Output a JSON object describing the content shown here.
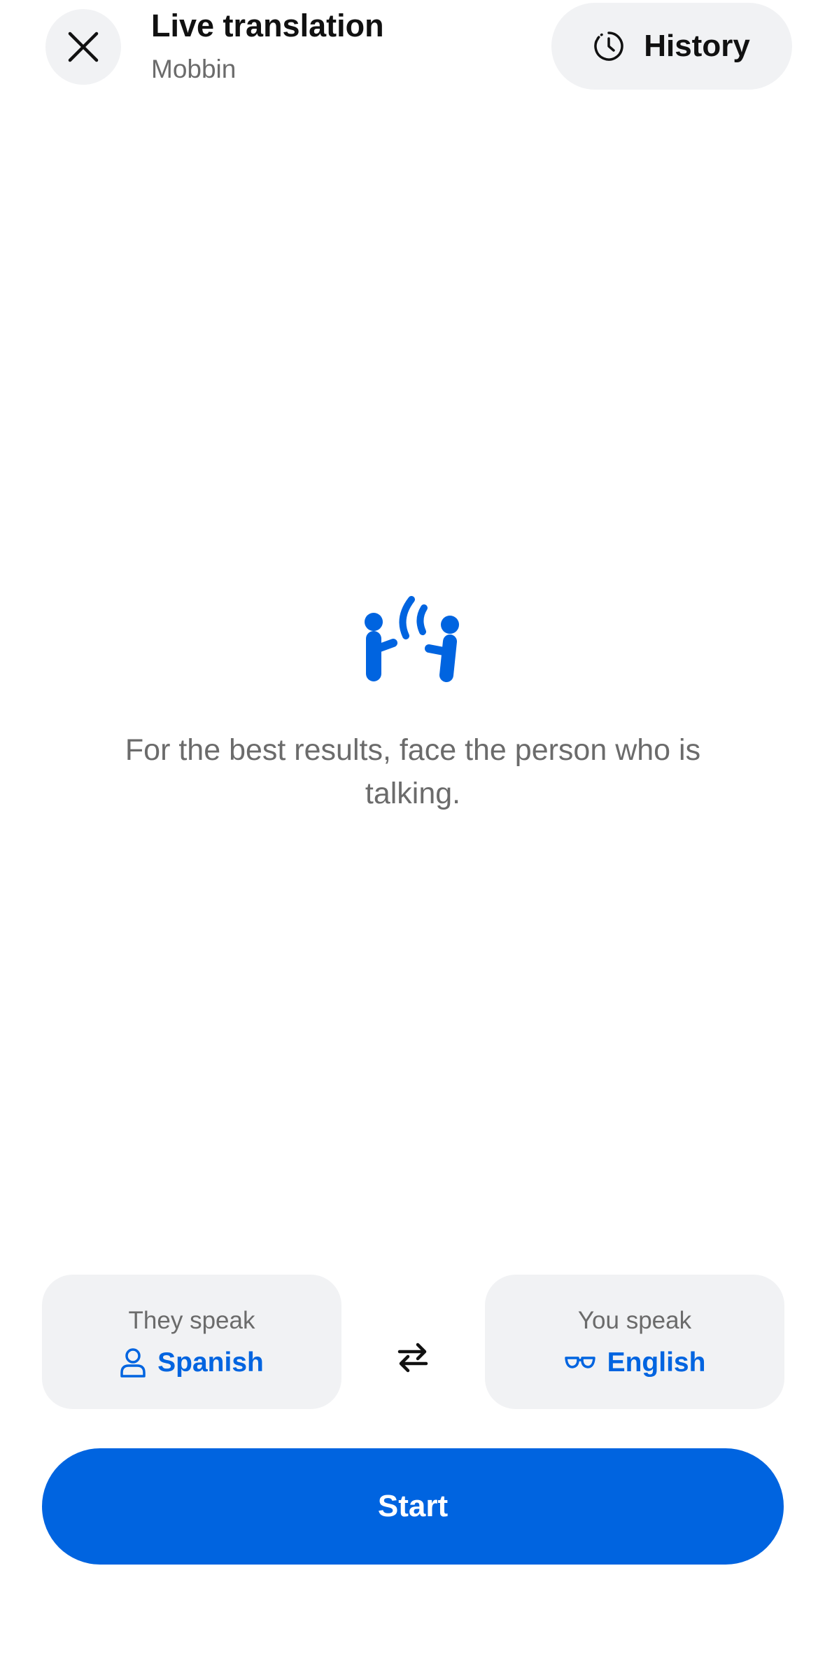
{
  "header": {
    "title": "Live translation",
    "subtitle": "Mobbin",
    "history_label": "History"
  },
  "icons": {
    "close": "close-icon",
    "history": "history-icon",
    "illustration": "conversation-icon",
    "they_speak": "person-icon",
    "you_speak": "glasses-icon",
    "swap": "swap-arrows-icon"
  },
  "main": {
    "hint": "For the best results, face the person who is talking."
  },
  "languages": {
    "they_speak_caption": "They speak",
    "they_speak_value": "Spanish",
    "you_speak_caption": "You speak",
    "you_speak_value": "English"
  },
  "actions": {
    "start_label": "Start"
  },
  "colors": {
    "accent": "#0064e0",
    "chip_bg": "#f1f2f4",
    "muted_text": "#6b6b6b"
  }
}
